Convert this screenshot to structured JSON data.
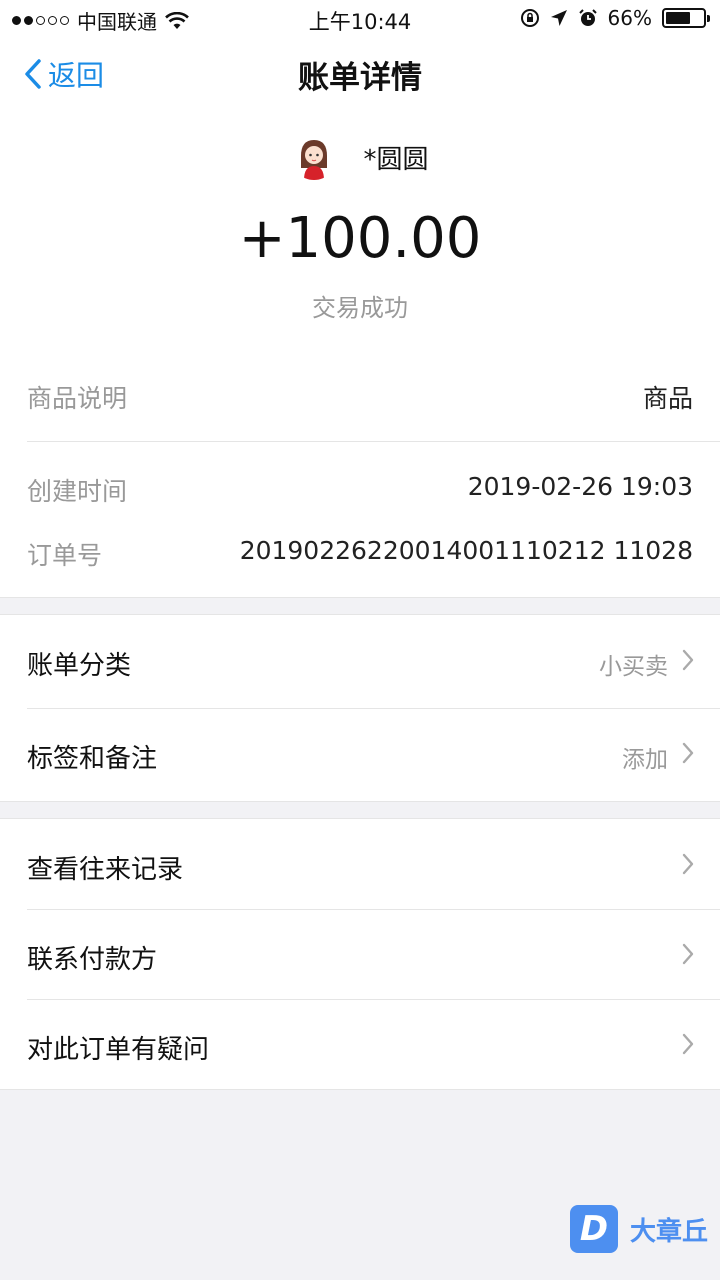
{
  "status_bar": {
    "carrier": "中国联通",
    "time": "上午10:44",
    "battery": "66%",
    "battery_level": 0.66,
    "icons": [
      "wifi-icon",
      "rotation-lock-icon",
      "location-icon",
      "alarm-icon",
      "battery-icon"
    ]
  },
  "nav": {
    "back_label": "返回",
    "title": "账单详情"
  },
  "payment": {
    "payer_name": "*圆圆",
    "amount": "+100.00",
    "status": "交易成功"
  },
  "details": {
    "product_label": "商品说明",
    "product_value": "商品",
    "created_label": "创建时间",
    "created_value": "2019-02-26 19:03",
    "order_label": "订单号",
    "order_value": "20190226220014001110212 11028"
  },
  "settings": {
    "category_label": "账单分类",
    "category_value": "小买卖",
    "tags_label": "标签和备注",
    "tags_value": "添加"
  },
  "actions": {
    "history_label": "查看往来记录",
    "contact_label": "联系付款方",
    "question_label": "对此订单有疑问"
  },
  "watermark": {
    "logo_letter": "D",
    "text": "大章丘"
  },
  "colors": {
    "accent": "#1b8ce6",
    "background": "#f2f2f5",
    "muted": "#999999"
  }
}
